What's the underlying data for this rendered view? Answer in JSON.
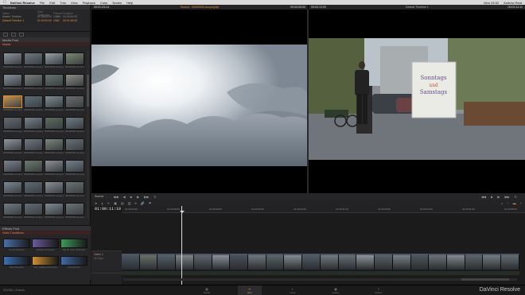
{
  "os_menu": {
    "app_name": "DaVinci Resolve",
    "items": [
      "File",
      "Edit",
      "Trim",
      "View",
      "Playback",
      "Color",
      "Nodes",
      "Help"
    ],
    "clock": "Mon 03:52",
    "user": "Andrew Reid"
  },
  "timelines_panel": {
    "title": "Timelines",
    "columns": [
      "Name",
      "Start Timecode",
      "Frames",
      "Duration"
    ],
    "rows": [
      {
        "name": "Master Timeline",
        "start": "01:00:00:00",
        "frames": "10860",
        "duration": "00:03:40:00"
      },
      {
        "name": "Default Timeline 1",
        "start": "01:00:00:00",
        "frames": "1960",
        "duration": "00:01:45:05"
      }
    ]
  },
  "media_pool": {
    "title": "Media Pool",
    "bin": "Master",
    "clip_label": "00000000.avcprojclip",
    "thumb_colors": [
      "#8d949c",
      "#6f7a80",
      "#9aa2a6",
      "#7c8a70",
      "#87909a",
      "#7a7f7a",
      "#66746c",
      "#8a8f84",
      "#c29350",
      "#5f6e78",
      "#7f8d92",
      "#6b6f6a",
      "#646a6f",
      "#788287",
      "#5d6b5e",
      "#6e7c84",
      "#8f979c",
      "#70787e",
      "#7d8479",
      "#6a7277",
      "#7a828a",
      "#6e7a6c",
      "#8a9096",
      "#74828a",
      "#7c8690",
      "#5f6a72",
      "#8a9094",
      "#6d7670",
      "#717b82",
      "#636d74",
      "#7f8a8e",
      "#6a7478"
    ],
    "selected_index": 8
  },
  "effects_library": {
    "title": "Effects Pool",
    "section": "Video Transitions",
    "items": [
      {
        "label": "Cross Dissolve",
        "color": "#4a6fa8"
      },
      {
        "label": "Additive Dissolve",
        "color": "#6a5aa0"
      },
      {
        "label": "Dip To Color Dissolve",
        "color": "#3a9a5a"
      },
      {
        "label": "Blur Dissolve",
        "color": "#3b70b5"
      },
      {
        "label": "Non-Additive Dissolve",
        "color": "#d0902c"
      },
      {
        "label": "Smooth Cut",
        "color": "#3f6aa5"
      }
    ]
  },
  "source_viewer": {
    "timecode_left": "00:01:23:14",
    "clip_name": "Source - 00000000.avcprojclip",
    "timecode_right": "00:00:00:00"
  },
  "record_viewer": {
    "timecode_left": "00:00:13:09",
    "timeline_name": "Default Timeline 1",
    "timecode_right": "00:01:11:11",
    "sign_line1": "Sonntags",
    "sign_line2": "und",
    "sign_line3": "Samstags"
  },
  "transport": {
    "source_label": "Source"
  },
  "timeline": {
    "timecode": "01:00:11:10",
    "ruler_ticks": [
      "01:00:00:00",
      "01:00:05:00",
      "01:00:09:00",
      "01:00:15:00",
      "01:00:22:00",
      "01:00:31:00",
      "01:00:36:00",
      "01:00:44:00",
      "01:00:51:00",
      "01:00:55:00"
    ],
    "video_track": "Video 1",
    "video_track_sub": "26 Clips",
    "clip_colors": [
      "#4b5560",
      "#6a6f66",
      "#556068",
      "#7d8486",
      "#5f666c",
      "#8a9096",
      "#4a5057",
      "#6f777c",
      "#5b6468",
      "#858c90",
      "#525b63",
      "#737a7e",
      "#666e72",
      "#8e9497",
      "#596166",
      "#7a8185",
      "#4f575d",
      "#6b7276",
      "#848a8e",
      "#5d6569",
      "#757c80",
      "#646c70"
    ]
  },
  "page_bar": {
    "project": "SOUND | Scenes",
    "pages": [
      "Media",
      "Edit",
      "Color",
      "Gallery",
      "Deliver"
    ],
    "active_page": 1,
    "brand": "DaVinci Resolve"
  }
}
